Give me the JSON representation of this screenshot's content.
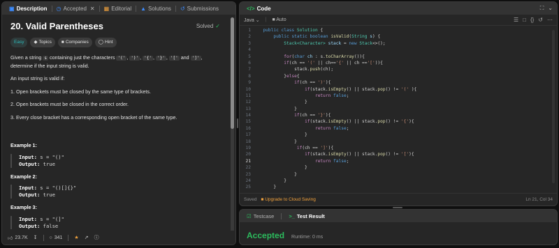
{
  "left_tabs": [
    {
      "label": "Description",
      "icon": "document-icon"
    },
    {
      "label": "Accepted",
      "icon": "clock-icon"
    },
    {
      "label": "Editorial",
      "icon": "book-icon"
    },
    {
      "label": "Solutions",
      "icon": "flask-icon"
    },
    {
      "label": "Submissions",
      "icon": "history-icon"
    }
  ],
  "problem": {
    "title": "20. Valid Parentheses",
    "status": "Solved",
    "chips": [
      "Easy",
      "Topics",
      "Companies",
      "Hint"
    ],
    "intro_1": "Given a string",
    "intro_s": "s",
    "intro_2": "containing just the characters",
    "chars": [
      "'('",
      "')'",
      "'{'",
      "'}'",
      "'['"
    ],
    "and_text": "and",
    "last_char": "']'",
    "intro_3": ", determine if the input string is valid.",
    "valid_intro": "An input string is valid if:",
    "rules": [
      "1. Open brackets must be closed by the same type of brackets.",
      "2. Open brackets must be closed in the correct order.",
      "3. Every close bracket has a corresponding open bracket of the same type."
    ],
    "examples": [
      {
        "title": "Example 1:",
        "input_label": "Input:",
        "input": "s = \"()\"",
        "output_label": "Output:",
        "output": "true"
      },
      {
        "title": "Example 2:",
        "input_label": "Input:",
        "input": "s = \"()[]{}\"",
        "output_label": "Output:",
        "output": "true"
      },
      {
        "title": "Example 3:",
        "input_label": "Input:",
        "input": "s = \"(]\"",
        "output_label": "Output:",
        "output": "false"
      }
    ]
  },
  "bottom_bar": {
    "likes": "23.7K",
    "comments": "341"
  },
  "code_panel": {
    "title": "Code",
    "language": "Java",
    "mode": "Auto",
    "saved": "Saved",
    "upgrade": "Upgrade to Cloud Saving",
    "cursor": "Ln 21, Col 34",
    "current_line": 21
  },
  "result_panel": {
    "testcase_tab": "Testcase",
    "result_tab": "Test Result",
    "status": "Accepted",
    "runtime": "Runtime: 0 ms"
  },
  "colors": {
    "accepted": "#2cbb5d",
    "accent": "#3c8cff",
    "upgrade": "#f0a13d"
  }
}
